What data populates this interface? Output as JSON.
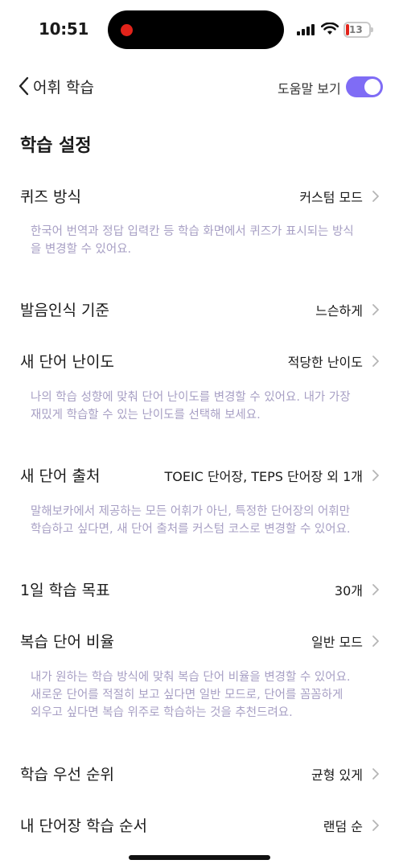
{
  "status_bar": {
    "time": "10:51",
    "battery_level": "13",
    "battery_color": "#e2231a"
  },
  "nav": {
    "back_icon": "chevron-left-icon",
    "title": "어휘 학습",
    "help_label": "도움말 보기",
    "help_toggle_on": true,
    "accent_color": "#7f6cf5"
  },
  "section_title": "학습 설정",
  "settings": [
    {
      "label": "퀴즈 방식",
      "value": "커스텀 모드",
      "description": [
        "한국어 번역과 정답 입력칸 등 학습 화면에서 퀴즈가 표시되는 방식",
        "을 변경할 수 있어요."
      ]
    },
    {
      "label": "발음인식 기준",
      "value": "느슨하게"
    },
    {
      "label": "새 단어 난이도",
      "value": "적당한 난이도",
      "description": [
        "나의 학습 성향에 맞춰 단어 난이도를 변경할 수 있어요. 내가 가장",
        "재밌게 학습할 수 있는 난이도를 선택해 보세요."
      ]
    },
    {
      "label": "새 단어 출처",
      "value": "TOEIC 단어장, TEPS 단어장 외 1개",
      "description": [
        "말해보카에서 제공하는 모든 어휘가 아닌, 특정한 단어장의 어휘만",
        "학습하고 싶다면, 새 단어 출처를 커스텀 코스로 변경할 수 있어요."
      ]
    },
    {
      "label": "1일 학습 목표",
      "value": "30개"
    },
    {
      "label": "복습 단어 비율",
      "value": "일반 모드",
      "description": [
        "내가 원하는 학습 방식에 맞춰 복습 단어 비율을 변경할 수 있어요.",
        "새로운 단어를 적절히 보고 싶다면 일반 모드로, 단어를 꼼꼼하게",
        "외우고 싶다면 복습 위주로 학습하는 것을 추천드려요."
      ]
    },
    {
      "label": "학습 우선 순위",
      "value": "균형 있게"
    },
    {
      "label": "내 단어장 학습 순서",
      "value": "랜덤 순"
    }
  ]
}
